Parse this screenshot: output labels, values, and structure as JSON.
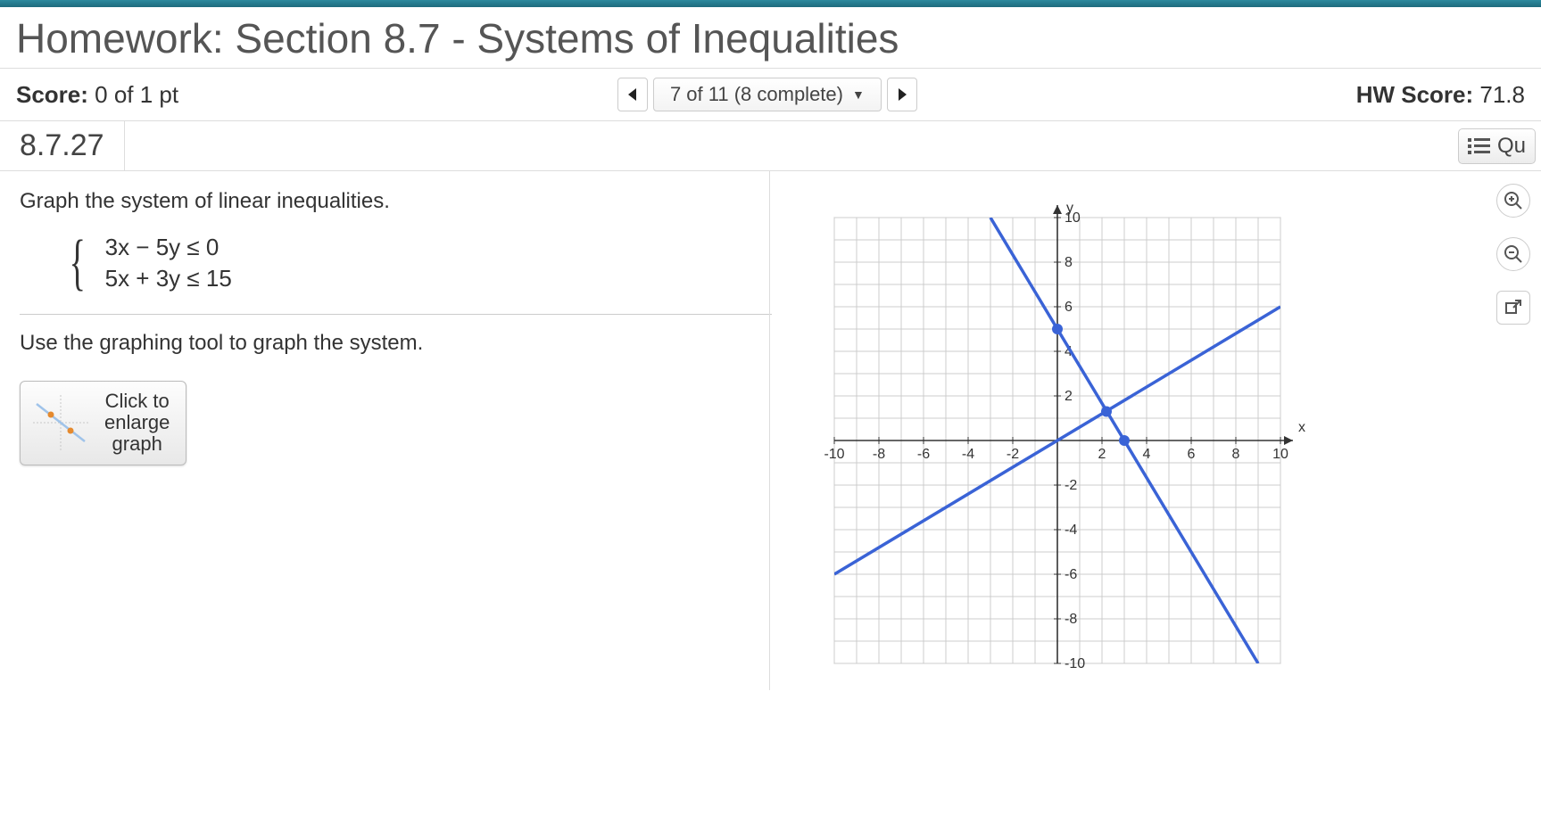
{
  "header": {
    "title": "Homework: Section 8.7 - Systems of Inequalities"
  },
  "scorebar": {
    "score_label": "Score:",
    "score_value": "0 of 1 pt",
    "nav_text": "7 of 11 (8 complete)",
    "hw_label": "HW Score:",
    "hw_value": "71.8"
  },
  "question": {
    "number": "8.7.27",
    "qu_button": "Qu",
    "prompt": "Graph the system of linear inequalities.",
    "eq1": "3x − 5y ≤ 0",
    "eq2": "5x + 3y ≤ 15",
    "instruction": "Use the graphing tool to graph the system.",
    "enlarge_l1": "Click to",
    "enlarge_l2": "enlarge",
    "enlarge_l3": "graph"
  },
  "chart_data": {
    "type": "line",
    "xlabel": "x",
    "ylabel": "y",
    "xlim": [
      -10,
      10
    ],
    "ylim": [
      -10,
      10
    ],
    "x_ticks": [
      -10,
      -8,
      -6,
      -4,
      -2,
      2,
      4,
      6,
      8,
      10
    ],
    "y_ticks": [
      -10,
      -8,
      -6,
      -4,
      -2,
      2,
      4,
      6,
      8,
      10
    ],
    "series": [
      {
        "name": "3x − 5y = 0",
        "points": [
          [
            -10,
            -6
          ],
          [
            10,
            6
          ]
        ],
        "marked_points": [
          [
            0,
            5
          ],
          [
            3,
            0
          ]
        ]
      },
      {
        "name": "5x + 3y = 15",
        "points": [
          [
            -3,
            10
          ],
          [
            9,
            -10
          ]
        ],
        "marked_points": [
          [
            2.2,
            1.3
          ]
        ]
      }
    ]
  }
}
